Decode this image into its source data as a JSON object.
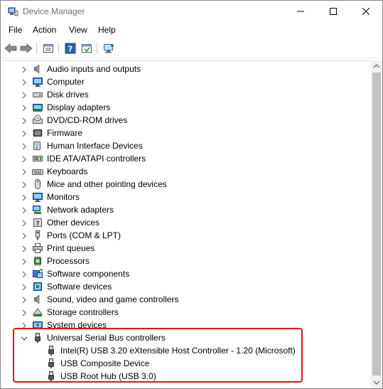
{
  "window": {
    "title": "Device Manager"
  },
  "menu": [
    {
      "id": "file",
      "label": "File"
    },
    {
      "id": "action",
      "label": "Action"
    },
    {
      "id": "view",
      "label": "View"
    },
    {
      "id": "help",
      "label": "Help"
    }
  ],
  "toolbar": [
    {
      "id": "back",
      "icon": "back-arrow-icon"
    },
    {
      "id": "forward",
      "icon": "forward-arrow-icon"
    },
    {
      "id": "properties",
      "icon": "properties-icon"
    },
    {
      "id": "help",
      "icon": "help-icon"
    },
    {
      "id": "update-driver",
      "icon": "update-driver-icon"
    },
    {
      "id": "scan",
      "icon": "scan-hardware-icon"
    }
  ],
  "tree": {
    "categories": [
      {
        "label": "Audio inputs and outputs",
        "icon": "speaker-icon",
        "expanded": false
      },
      {
        "label": "Computer",
        "icon": "monitor-icon",
        "expanded": false
      },
      {
        "label": "Disk drives",
        "icon": "disk-drive-icon",
        "expanded": false
      },
      {
        "label": "Display adapters",
        "icon": "display-adapter-icon",
        "expanded": false
      },
      {
        "label": "DVD/CD-ROM drives",
        "icon": "dvd-drive-icon",
        "expanded": false
      },
      {
        "label": "Firmware",
        "icon": "firmware-icon",
        "expanded": false
      },
      {
        "label": "Human Interface Devices",
        "icon": "hid-icon",
        "expanded": false
      },
      {
        "label": "IDE ATA/ATAPI controllers",
        "icon": "ide-controller-icon",
        "expanded": false
      },
      {
        "label": "Keyboards",
        "icon": "keyboard-icon",
        "expanded": false
      },
      {
        "label": "Mice and other pointing devices",
        "icon": "mouse-icon",
        "expanded": false
      },
      {
        "label": "Monitors",
        "icon": "monitor-icon",
        "expanded": false
      },
      {
        "label": "Network adapters",
        "icon": "network-adapter-icon",
        "expanded": false
      },
      {
        "label": "Other devices",
        "icon": "other-devices-icon",
        "expanded": false
      },
      {
        "label": "Ports (COM & LPT)",
        "icon": "port-icon",
        "expanded": false
      },
      {
        "label": "Print queues",
        "icon": "printer-icon",
        "expanded": false
      },
      {
        "label": "Processors",
        "icon": "processor-icon",
        "expanded": false
      },
      {
        "label": "Software components",
        "icon": "software-component-icon",
        "expanded": false
      },
      {
        "label": "Software devices",
        "icon": "software-device-icon",
        "expanded": false
      },
      {
        "label": "Sound, video and game controllers",
        "icon": "speaker-icon",
        "expanded": false
      },
      {
        "label": "Storage controllers",
        "icon": "storage-controller-icon",
        "expanded": false
      },
      {
        "label": "System devices",
        "icon": "system-devices-icon",
        "expanded": false
      },
      {
        "label": "Universal Serial Bus controllers",
        "icon": "usb-icon",
        "expanded": true,
        "children": [
          {
            "label": "Intel(R) USB 3.20 eXtensible Host Controller - 1.20 (Microsoft)",
            "icon": "usb-icon"
          },
          {
            "label": "USB Composite Device",
            "icon": "usb-icon"
          },
          {
            "label": "USB Root Hub (USB 3.0)",
            "icon": "usb-icon"
          }
        ]
      }
    ]
  },
  "colors": {
    "highlight": "#e0141e",
    "scrollbar_thumb": "#c2c2c2"
  }
}
